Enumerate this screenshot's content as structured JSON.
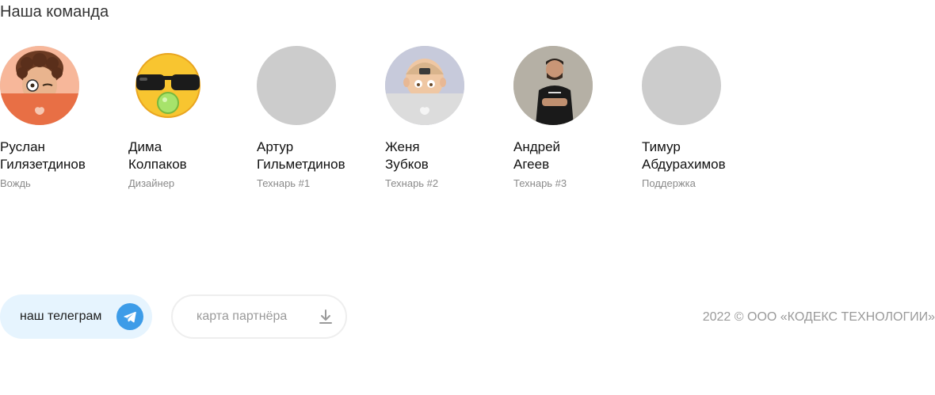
{
  "section_title": "Наша команда",
  "team": [
    {
      "first": "Руслан",
      "last": "Гилязетдинов",
      "role": "Вождь",
      "avatar_icon": "memoji-curly-laptop"
    },
    {
      "first": "Дима",
      "last": "Колпаков",
      "role": "Дизайнер",
      "avatar_icon": "emoji-sunglasses-bubblegum"
    },
    {
      "first": "Артур",
      "last": "Гильметдинов",
      "role": "Технарь #1",
      "avatar_icon": "avatar-placeholder"
    },
    {
      "first": "Женя",
      "last": "Зубков",
      "role": "Технарь #2",
      "avatar_icon": "memoji-cap-laptop"
    },
    {
      "first": "Андрей",
      "last": "Агеев",
      "role": "Технарь #3",
      "avatar_icon": "photo-person"
    },
    {
      "first": "Тимур",
      "last": "Абдурахимов",
      "role": "Поддержка",
      "avatar_icon": "avatar-placeholder"
    }
  ],
  "buttons": {
    "telegram_label": "наш телеграм",
    "partner_label": "карта партнёра"
  },
  "footer": {
    "copyright": "2022 © ООО «КОДЕКС ТЕХНОЛОГИИ»"
  },
  "colors": {
    "telegram_bg": "#e6f4fe",
    "telegram_icon": "#3d9ce8",
    "placeholder": "#cccccc"
  }
}
